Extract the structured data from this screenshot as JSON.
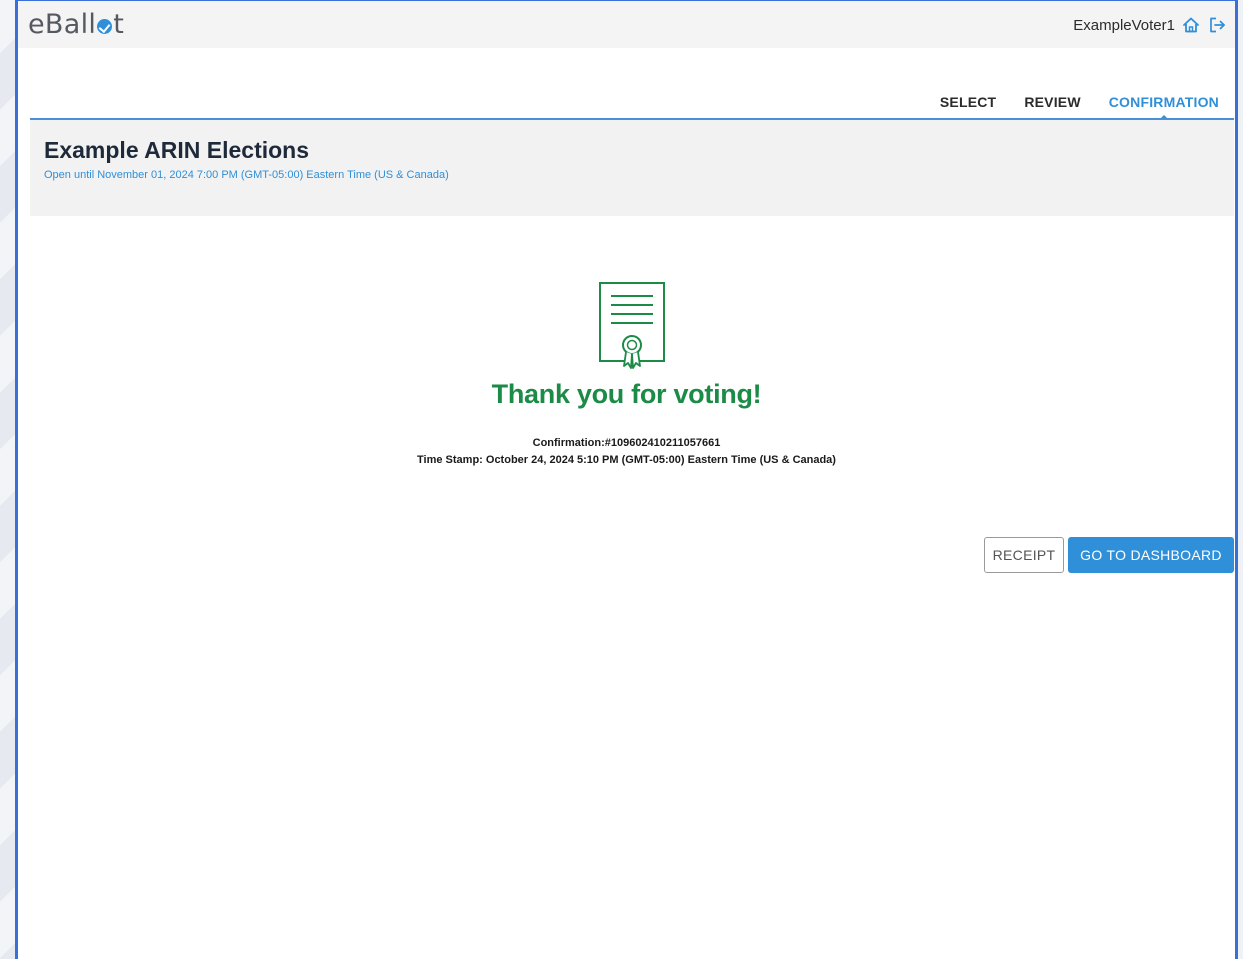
{
  "app": {
    "logo_text_left": "eBall",
    "logo_text_right": "t"
  },
  "user": {
    "name": "ExampleVoter1"
  },
  "steps": [
    {
      "label": "SELECT"
    },
    {
      "label": "REVIEW"
    },
    {
      "label": "CONFIRMATION"
    }
  ],
  "election": {
    "title": "Example ARIN Elections",
    "subtitle": "Open until November 01, 2024 7:00 PM (GMT-05:00) Eastern Time (US & Canada)"
  },
  "confirmation": {
    "heading": "Thank you for voting!",
    "confirmation_line": "Confirmation:#109602410211057661",
    "timestamp_line": "Time Stamp: October 24, 2024 5:10 PM (GMT-05:00) Eastern Time (US & Canada)"
  },
  "actions": {
    "receipt_label": "RECEIPT",
    "dashboard_label": "GO TO DASHBOARD"
  },
  "icons": {
    "logo_mark": "check-circle-icon",
    "home": "home-icon",
    "logout": "logout-icon",
    "certificate": "certificate-icon"
  },
  "colors": {
    "accent": "#2f8fd8",
    "success": "#1b8b47",
    "frame": "#3a6fd8"
  }
}
